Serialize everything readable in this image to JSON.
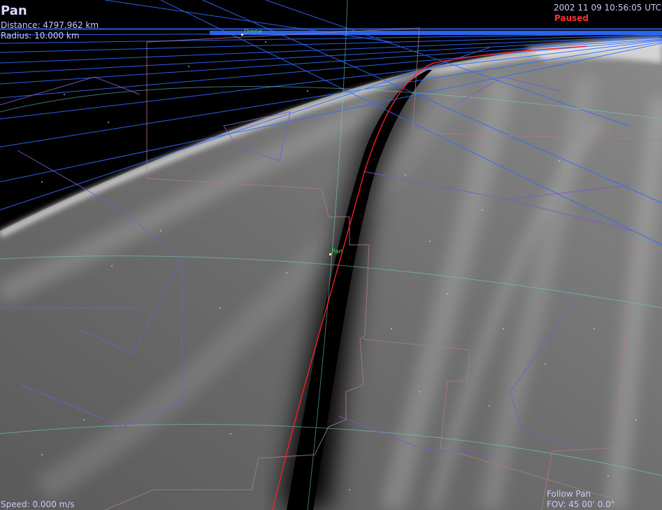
{
  "object": {
    "name": "Pan",
    "distance": "Distance: 4797.962 km",
    "radius": "Radius: 10.000 km"
  },
  "time": {
    "datetime": "2002 11 09 10:56:05 UTC",
    "status": "Paused"
  },
  "speed": "Speed: 0.000 m/s",
  "view": {
    "follow": "Follow Pan",
    "fov": "FOV: 45 00' 0.0\""
  },
  "labels": {
    "dione": "Dione",
    "pan": "Pan"
  },
  "colors": {
    "hud_text": "#c9c9ff",
    "paused": "#ff3030",
    "object_label": "#3cdc3c",
    "orbit": "#ff2020",
    "grid_lines": "#2f6bff",
    "constellation": "#7a5acd",
    "boundaries": "#b07a8a"
  }
}
